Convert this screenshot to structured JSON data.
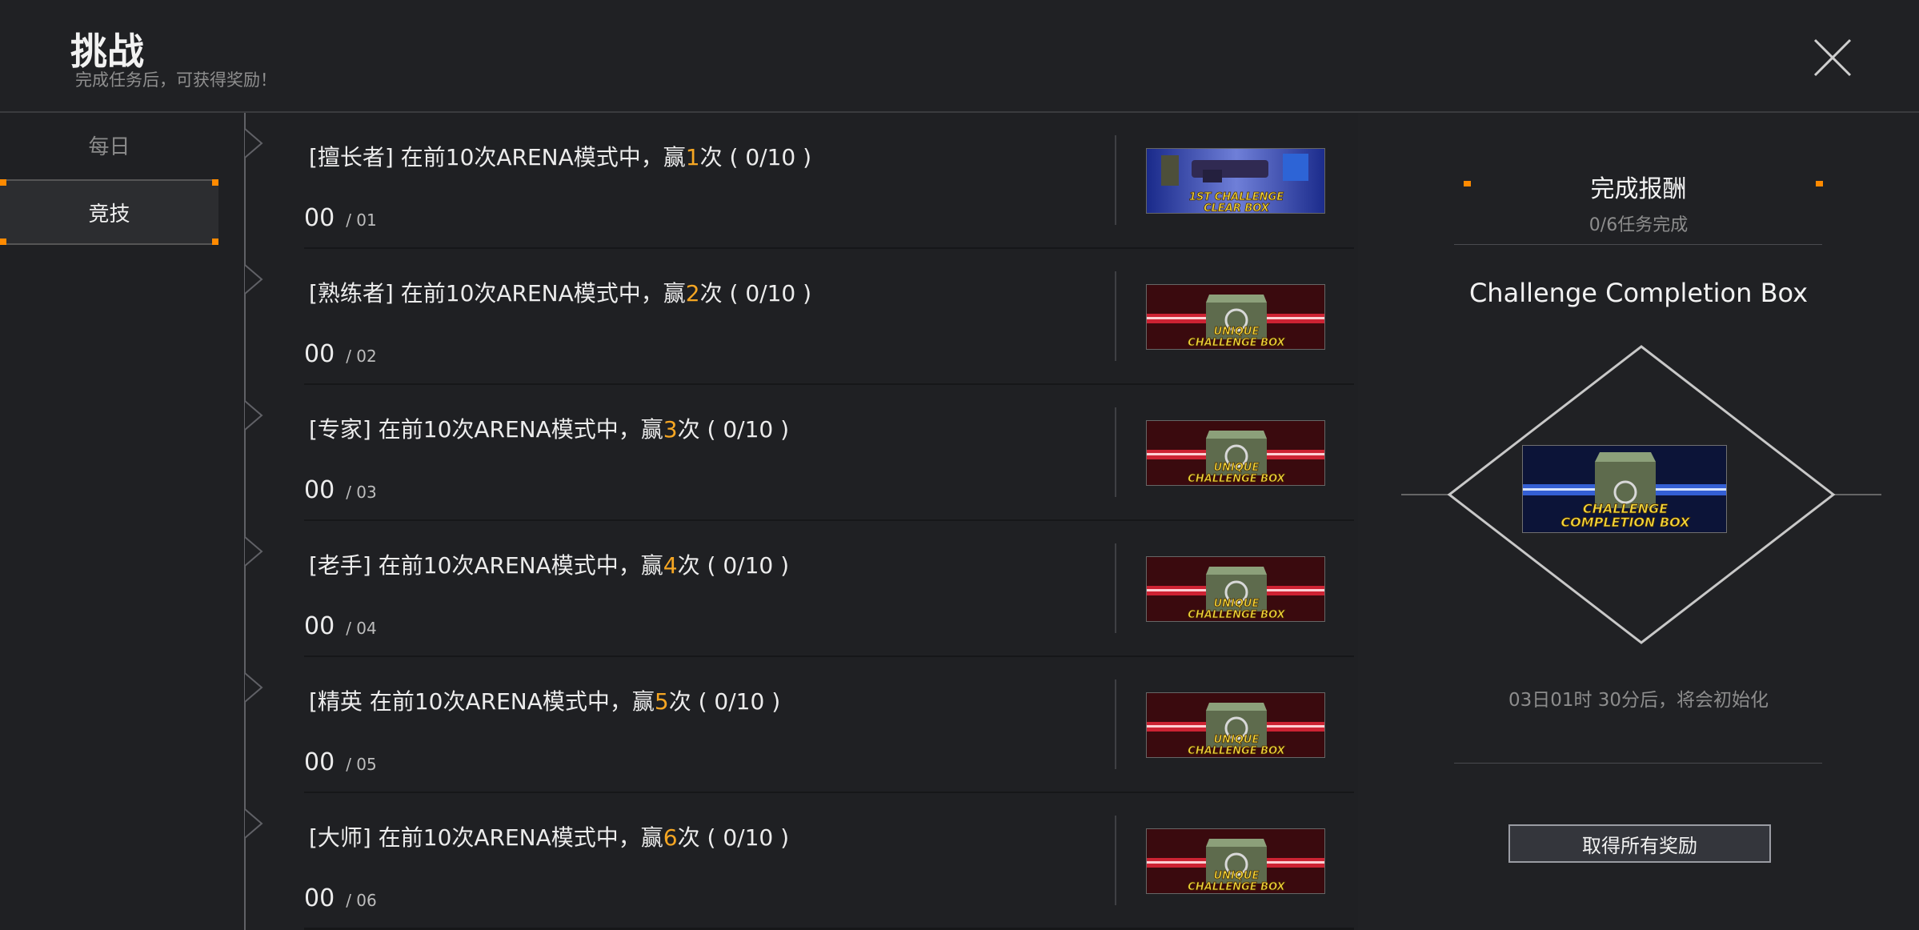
{
  "header": {
    "title": "挑战",
    "subtitle": "完成任务后，可获得奖励！",
    "close_icon": "close-x-icon"
  },
  "sidebar": {
    "tabs": [
      {
        "label": "每日",
        "active": false
      },
      {
        "label": "竞技",
        "active": true
      }
    ],
    "accent_color": "#ff8a00"
  },
  "challenges": [
    {
      "prefix": "[擅长者] 在前10次ARENA模式中，赢",
      "wins": "1",
      "suffix": "次 ( 0/10 )",
      "count": "00",
      "index": "/ 01",
      "reward_line1": "1ST CHALLENGE",
      "reward_line2": "CLEAR BOX",
      "reward_type": "first-clear"
    },
    {
      "prefix": "[熟练者] 在前10次ARENA模式中，赢",
      "wins": "2",
      "suffix": "次 ( 0/10 )",
      "count": "00",
      "index": "/ 02",
      "reward_line1": "UNIQUE",
      "reward_line2": "CHALLENGE BOX",
      "reward_type": "unique"
    },
    {
      "prefix": "[专家] 在前10次ARENA模式中，赢",
      "wins": "3",
      "suffix": "次 ( 0/10 )",
      "count": "00",
      "index": "/ 03",
      "reward_line1": "UNIQUE",
      "reward_line2": "CHALLENGE BOX",
      "reward_type": "unique"
    },
    {
      "prefix": "[老手] 在前10次ARENA模式中，赢",
      "wins": "4",
      "suffix": "次 ( 0/10 )",
      "count": "00",
      "index": "/ 04",
      "reward_line1": "UNIQUE",
      "reward_line2": "CHALLENGE BOX",
      "reward_type": "unique"
    },
    {
      "prefix": "[精英 在前10次ARENA模式中，赢",
      "wins": "5",
      "suffix": "次 ( 0/10 )",
      "count": "00",
      "index": "/ 05",
      "reward_line1": "UNIQUE",
      "reward_line2": "CHALLENGE BOX",
      "reward_type": "unique"
    },
    {
      "prefix": "[大师] 在前10次ARENA模式中，赢",
      "wins": "6",
      "suffix": "次 ( 0/10 )",
      "count": "00",
      "index": "/ 06",
      "reward_line1": "UNIQUE",
      "reward_line2": "CHALLENGE BOX",
      "reward_type": "unique"
    }
  ],
  "panel": {
    "title": "完成报酬",
    "progress": "0/6任务完成",
    "box_name": "Challenge Completion Box",
    "box_line1": "CHALLENGE",
    "box_line2": "COMPLETION BOX",
    "reset_text": "03日01时 30分后，将会初始化",
    "claim_button": "取得所有奖励"
  },
  "colors": {
    "highlight": "#f5a623",
    "accent": "#ff8a00",
    "background": "#1f2023"
  }
}
